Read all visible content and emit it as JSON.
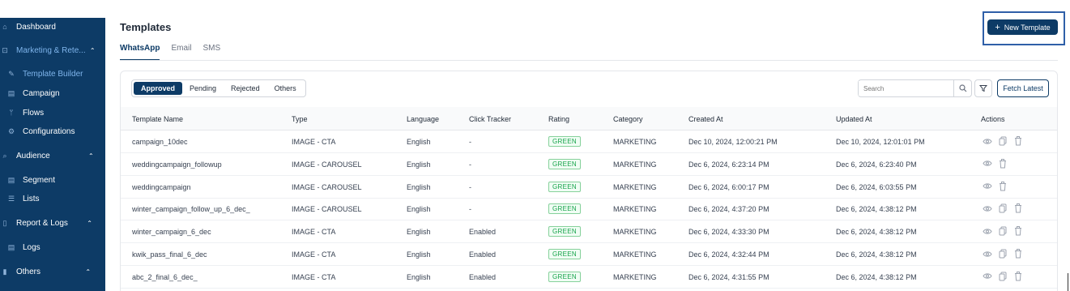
{
  "sidebar": {
    "items": [
      {
        "label": "Dashboard",
        "icon": "home-icon"
      },
      {
        "label": "Marketing & Rete...",
        "icon": "megaphone-icon"
      },
      {
        "label": "Template Builder",
        "icon": "brush-icon"
      },
      {
        "label": "Campaign",
        "icon": "document-icon"
      },
      {
        "label": "Flows",
        "icon": "flow-icon"
      },
      {
        "label": "Configurations",
        "icon": "settings-icon"
      },
      {
        "label": "Audience",
        "icon": "search-icon"
      },
      {
        "label": "Segment",
        "icon": "segment-icon"
      },
      {
        "label": "Lists",
        "icon": "list-icon"
      },
      {
        "label": "Report & Logs",
        "icon": "report-icon"
      },
      {
        "label": "Logs",
        "icon": "log-icon"
      },
      {
        "label": "Others",
        "icon": "bar-icon"
      }
    ]
  },
  "header": {
    "title": "Templates",
    "tabs": [
      {
        "label": "WhatsApp"
      },
      {
        "label": "Email"
      },
      {
        "label": "SMS"
      }
    ],
    "new_template_label": "New Template"
  },
  "toolbar": {
    "filters": [
      {
        "label": "Approved"
      },
      {
        "label": "Pending"
      },
      {
        "label": "Rejected"
      },
      {
        "label": "Others"
      }
    ],
    "search_placeholder": "Search",
    "fetch_label": "Fetch Latest"
  },
  "table": {
    "columns": {
      "name": "Template Name",
      "type": "Type",
      "language": "Language",
      "click_tracker": "Click Tracker",
      "rating": "Rating",
      "category": "Category",
      "created": "Created At",
      "updated": "Updated At",
      "actions": "Actions"
    },
    "rows": [
      {
        "name": "campaign_10dec",
        "type": "IMAGE - CTA",
        "language": "English",
        "click_tracker": "-",
        "rating": "GREEN",
        "category": "MARKETING",
        "created": "Dec 10, 2024, 12:00:21 PM",
        "updated": "Dec 10, 2024, 12:01:01 PM"
      },
      {
        "name": "weddingcampaign_followup",
        "type": "IMAGE - CAROUSEL",
        "language": "English",
        "click_tracker": "-",
        "rating": "GREEN",
        "category": "MARKETING",
        "created": "Dec 6, 2024, 6:23:14 PM",
        "updated": "Dec 6, 2024, 6:23:40 PM"
      },
      {
        "name": "weddingcampaign",
        "type": "IMAGE - CAROUSEL",
        "language": "English",
        "click_tracker": "-",
        "rating": "GREEN",
        "category": "MARKETING",
        "created": "Dec 6, 2024, 6:00:17 PM",
        "updated": "Dec 6, 2024, 6:03:55 PM"
      },
      {
        "name": "winter_campaign_follow_up_6_dec_",
        "type": "IMAGE - CAROUSEL",
        "language": "English",
        "click_tracker": "-",
        "rating": "GREEN",
        "category": "MARKETING",
        "created": "Dec 6, 2024, 4:37:20 PM",
        "updated": "Dec 6, 2024, 4:38:12 PM"
      },
      {
        "name": "winter_campaign_6_dec",
        "type": "IMAGE - CTA",
        "language": "English",
        "click_tracker": "Enabled",
        "rating": "GREEN",
        "category": "MARKETING",
        "created": "Dec 6, 2024, 4:33:30 PM",
        "updated": "Dec 6, 2024, 4:38:12 PM"
      },
      {
        "name": "kwik_pass_final_6_dec",
        "type": "IMAGE - CTA",
        "language": "English",
        "click_tracker": "Enabled",
        "rating": "GREEN",
        "category": "MARKETING",
        "created": "Dec 6, 2024, 4:32:44 PM",
        "updated": "Dec 6, 2024, 4:38:12 PM"
      },
      {
        "name": "abc_2_final_6_dec_",
        "type": "IMAGE - CTA",
        "language": "English",
        "click_tracker": "Enabled",
        "rating": "GREEN",
        "category": "MARKETING",
        "created": "Dec 6, 2024, 4:31:55 PM",
        "updated": "Dec 6, 2024, 4:38:12 PM"
      }
    ]
  },
  "colors": {
    "brand": "#0d3b66",
    "rating_green": "#16a34a"
  }
}
